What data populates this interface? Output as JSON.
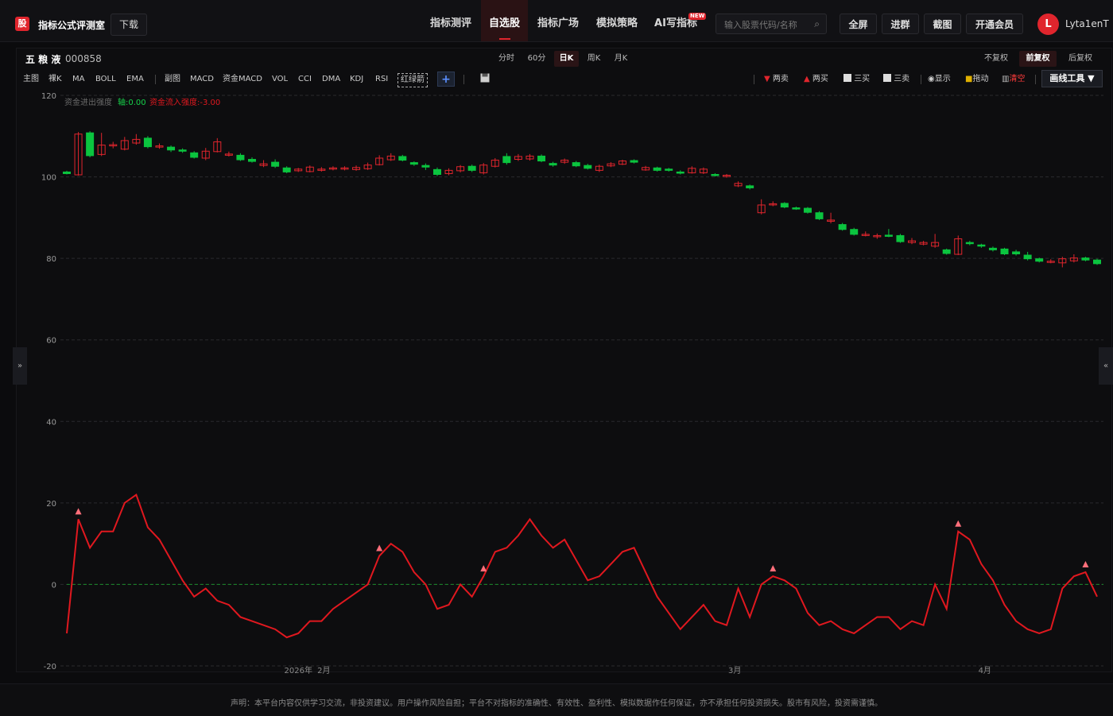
{
  "app": {
    "logo_char": "股",
    "brand": "指标公式评测室",
    "download": "下载"
  },
  "nav": {
    "items": [
      "指标测评",
      "自选股",
      "指标广场",
      "模拟策略",
      "AI写指标"
    ],
    "active": "自选股",
    "new_badge": "NEW"
  },
  "search": {
    "placeholder": "输入股票代码/名称"
  },
  "toolbar": {
    "fullscreen": "全屏",
    "join_group": "进群",
    "screenshot": "截图",
    "membership": "开通会员"
  },
  "user": {
    "avatar_letter": "L",
    "name": "Lyta1enT"
  },
  "stock": {
    "name": "五 粮 液",
    "code": "000858"
  },
  "periods": [
    "分时",
    "60分",
    "日K",
    "周K",
    "月K"
  ],
  "active_period": "日K",
  "adjust": [
    "不复权",
    "前复权",
    "后复权"
  ],
  "active_adjust": "前复权",
  "indicators": [
    "主图",
    "裸K",
    "MA",
    "BOLL",
    "EMA",
    "副图",
    "MACD",
    "资金MACD",
    "VOL",
    "CCI",
    "DMA",
    "KDJ",
    "RSI",
    "红绿箭"
  ],
  "signal_tools": [
    "两卖",
    "两买",
    "三买",
    "三卖",
    "显示",
    "拖动",
    "清空"
  ],
  "draw_tool": "画线工具 ▼",
  "side_arrows": {
    "left": "»",
    "right": "«"
  },
  "colors": {
    "up": "#e0252d",
    "down": "#0bc43f",
    "line": "#e0181f",
    "zero": "#1a8a2a"
  },
  "chart_data": {
    "type": "candlestick+line",
    "y_ticks": [
      "120",
      "100",
      "80",
      "60",
      "40",
      "20",
      "0",
      "-20"
    ],
    "ylim": [
      -20,
      120
    ],
    "x_ticks": [
      "2026年",
      "2月",
      "3月",
      "4月"
    ],
    "legend": {
      "label1": "资金进出强度",
      "label2": "轴:0.00",
      "label3": "资金流入强度:-3.00"
    },
    "candles": [
      {
        "o": 101.2,
        "c": 100.8,
        "h": 101.5,
        "l": 100.6
      },
      {
        "o": 100.5,
        "c": 110.5,
        "h": 111.0,
        "l": 100.3
      },
      {
        "o": 110.8,
        "c": 105.2,
        "h": 111.2,
        "l": 104.8
      },
      {
        "o": 105.5,
        "c": 107.8,
        "h": 110.8,
        "l": 105.1
      },
      {
        "o": 107.6,
        "c": 107.9,
        "h": 108.6,
        "l": 107.0
      },
      {
        "o": 106.8,
        "c": 108.9,
        "h": 109.8,
        "l": 106.5
      },
      {
        "o": 108.3,
        "c": 109.2,
        "h": 110.5,
        "l": 107.9
      },
      {
        "o": 109.5,
        "c": 107.4,
        "h": 110.0,
        "l": 107.0
      },
      {
        "o": 107.3,
        "c": 107.6,
        "h": 108.2,
        "l": 106.9
      },
      {
        "o": 107.3,
        "c": 106.6,
        "h": 107.7,
        "l": 106.1
      },
      {
        "o": 106.6,
        "c": 106.3,
        "h": 107.0,
        "l": 105.9
      },
      {
        "o": 105.9,
        "c": 104.8,
        "h": 106.3,
        "l": 104.5
      },
      {
        "o": 104.6,
        "c": 106.3,
        "h": 107.1,
        "l": 104.1
      },
      {
        "o": 106.2,
        "c": 108.6,
        "h": 109.5,
        "l": 106.0
      },
      {
        "o": 105.4,
        "c": 105.6,
        "h": 106.2,
        "l": 105.0
      },
      {
        "o": 105.3,
        "c": 104.2,
        "h": 105.8,
        "l": 103.9
      },
      {
        "o": 104.3,
        "c": 103.8,
        "h": 104.8,
        "l": 103.5
      },
      {
        "o": 102.8,
        "c": 103.2,
        "h": 104.1,
        "l": 102.4
      },
      {
        "o": 103.6,
        "c": 102.6,
        "h": 104.3,
        "l": 102.2
      },
      {
        "o": 102.2,
        "c": 101.2,
        "h": 102.6,
        "l": 100.9
      },
      {
        "o": 101.5,
        "c": 101.9,
        "h": 102.2,
        "l": 101.2
      },
      {
        "o": 101.3,
        "c": 102.4,
        "h": 102.8,
        "l": 101.1
      },
      {
        "o": 101.6,
        "c": 101.9,
        "h": 102.4,
        "l": 101.3
      },
      {
        "o": 102.0,
        "c": 102.2,
        "h": 102.6,
        "l": 101.6
      },
      {
        "o": 101.9,
        "c": 102.2,
        "h": 102.6,
        "l": 101.6
      },
      {
        "o": 101.8,
        "c": 102.3,
        "h": 102.8,
        "l": 101.5
      },
      {
        "o": 102.0,
        "c": 102.9,
        "h": 103.5,
        "l": 101.7
      },
      {
        "o": 103.0,
        "c": 104.6,
        "h": 105.3,
        "l": 102.8
      },
      {
        "o": 104.2,
        "c": 105.1,
        "h": 105.8,
        "l": 103.9
      },
      {
        "o": 105.0,
        "c": 104.1,
        "h": 105.4,
        "l": 103.8
      },
      {
        "o": 103.5,
        "c": 103.1,
        "h": 103.8,
        "l": 102.7
      },
      {
        "o": 102.8,
        "c": 102.4,
        "h": 103.3,
        "l": 101.7
      },
      {
        "o": 101.8,
        "c": 100.6,
        "h": 102.3,
        "l": 100.2
      },
      {
        "o": 100.8,
        "c": 101.6,
        "h": 102.1,
        "l": 100.4
      },
      {
        "o": 101.5,
        "c": 102.5,
        "h": 102.9,
        "l": 101.1
      },
      {
        "o": 102.6,
        "c": 101.6,
        "h": 103.0,
        "l": 101.2
      },
      {
        "o": 101.0,
        "c": 102.9,
        "h": 103.4,
        "l": 100.6
      },
      {
        "o": 102.6,
        "c": 104.1,
        "h": 104.6,
        "l": 102.3
      },
      {
        "o": 105.0,
        "c": 103.5,
        "h": 105.8,
        "l": 103.0
      },
      {
        "o": 104.3,
        "c": 105.0,
        "h": 105.6,
        "l": 103.9
      },
      {
        "o": 104.4,
        "c": 105.1,
        "h": 105.6,
        "l": 104.0
      },
      {
        "o": 105.1,
        "c": 103.9,
        "h": 105.5,
        "l": 103.6
      },
      {
        "o": 103.3,
        "c": 102.9,
        "h": 103.7,
        "l": 102.5
      },
      {
        "o": 103.6,
        "c": 104.1,
        "h": 104.5,
        "l": 103.2
      },
      {
        "o": 103.5,
        "c": 102.7,
        "h": 103.9,
        "l": 102.4
      },
      {
        "o": 102.8,
        "c": 102.1,
        "h": 103.2,
        "l": 101.8
      },
      {
        "o": 101.6,
        "c": 102.6,
        "h": 103.0,
        "l": 101.2
      },
      {
        "o": 102.7,
        "c": 103.2,
        "h": 103.6,
        "l": 102.4
      },
      {
        "o": 103.1,
        "c": 103.9,
        "h": 104.2,
        "l": 102.9
      },
      {
        "o": 104.0,
        "c": 103.6,
        "h": 104.3,
        "l": 103.3
      },
      {
        "o": 101.7,
        "c": 102.3,
        "h": 102.7,
        "l": 101.5
      },
      {
        "o": 102.2,
        "c": 101.6,
        "h": 102.5,
        "l": 101.3
      },
      {
        "o": 101.9,
        "c": 101.6,
        "h": 102.2,
        "l": 101.3
      },
      {
        "o": 101.2,
        "c": 100.9,
        "h": 101.6,
        "l": 100.6
      },
      {
        "o": 101.0,
        "c": 102.1,
        "h": 102.6,
        "l": 100.8
      },
      {
        "o": 101.0,
        "c": 101.9,
        "h": 102.3,
        "l": 100.7
      },
      {
        "o": 100.6,
        "c": 100.4,
        "h": 100.9,
        "l": 100.1
      },
      {
        "o": 100.1,
        "c": 100.4,
        "h": 100.7,
        "l": 99.8
      },
      {
        "o": 97.8,
        "c": 98.4,
        "h": 98.9,
        "l": 97.5
      },
      {
        "o": 97.8,
        "c": 97.3,
        "h": 98.1,
        "l": 96.9
      },
      {
        "o": 91.2,
        "c": 93.1,
        "h": 94.5,
        "l": 90.8
      },
      {
        "o": 93.2,
        "c": 93.4,
        "h": 94.0,
        "l": 92.8
      },
      {
        "o": 93.5,
        "c": 92.6,
        "h": 93.8,
        "l": 92.3
      },
      {
        "o": 92.4,
        "c": 92.2,
        "h": 92.7,
        "l": 91.9
      },
      {
        "o": 92.3,
        "c": 91.3,
        "h": 92.6,
        "l": 91.0
      },
      {
        "o": 91.2,
        "c": 89.7,
        "h": 91.6,
        "l": 89.4
      },
      {
        "o": 89.2,
        "c": 89.4,
        "h": 91.2,
        "l": 88.6
      },
      {
        "o": 88.3,
        "c": 87.1,
        "h": 88.7,
        "l": 86.8
      },
      {
        "o": 87.1,
        "c": 85.9,
        "h": 87.5,
        "l": 85.6
      },
      {
        "o": 85.7,
        "c": 85.9,
        "h": 86.6,
        "l": 85.4
      },
      {
        "o": 85.4,
        "c": 85.6,
        "h": 86.1,
        "l": 84.8
      },
      {
        "o": 85.7,
        "c": 85.6,
        "h": 87.2,
        "l": 85.2
      },
      {
        "o": 85.6,
        "c": 84.1,
        "h": 86.0,
        "l": 83.8
      },
      {
        "o": 83.9,
        "c": 84.3,
        "h": 85.0,
        "l": 83.5
      },
      {
        "o": 83.5,
        "c": 83.9,
        "h": 84.3,
        "l": 83.2
      },
      {
        "o": 83.0,
        "c": 83.9,
        "h": 86.0,
        "l": 82.6
      },
      {
        "o": 82.1,
        "c": 81.2,
        "h": 82.4,
        "l": 80.9
      },
      {
        "o": 81.0,
        "c": 84.8,
        "h": 85.6,
        "l": 80.8
      },
      {
        "o": 83.9,
        "c": 83.6,
        "h": 84.3,
        "l": 83.2
      },
      {
        "o": 83.3,
        "c": 83.0,
        "h": 83.6,
        "l": 82.6
      },
      {
        "o": 82.5,
        "c": 82.1,
        "h": 82.9,
        "l": 81.7
      },
      {
        "o": 82.3,
        "c": 81.1,
        "h": 82.6,
        "l": 80.8
      },
      {
        "o": 81.6,
        "c": 81.1,
        "h": 82.1,
        "l": 80.7
      },
      {
        "o": 80.8,
        "c": 79.9,
        "h": 81.6,
        "l": 79.5
      },
      {
        "o": 79.9,
        "c": 79.3,
        "h": 80.2,
        "l": 79.0
      },
      {
        "o": 79.1,
        "c": 79.3,
        "h": 79.8,
        "l": 78.8
      },
      {
        "o": 78.9,
        "c": 79.9,
        "h": 80.4,
        "l": 77.8
      },
      {
        "o": 79.4,
        "c": 80.1,
        "h": 81.0,
        "l": 79.0
      },
      {
        "o": 80.1,
        "c": 79.6,
        "h": 80.4,
        "l": 79.3
      },
      {
        "o": 79.6,
        "c": 78.7,
        "h": 79.9,
        "l": 78.4
      }
    ],
    "line": [
      -12.0,
      16.0,
      9.0,
      13.0,
      13.0,
      20.0,
      22.0,
      14.0,
      11.0,
      6.0,
      1.0,
      -3.0,
      -1.0,
      -4.0,
      -5.0,
      -8.0,
      -9.0,
      -10.0,
      -11.0,
      -13.0,
      -12.0,
      -9.0,
      -9.0,
      -6.0,
      -4.0,
      -2.0,
      0.0,
      7.0,
      10.0,
      8.0,
      3.0,
      0.0,
      -6.0,
      -5.0,
      0.0,
      -3.0,
      2.0,
      8.0,
      9.0,
      12.0,
      16.0,
      12.0,
      9.0,
      11.0,
      6.0,
      1.0,
      2.0,
      5.0,
      8.0,
      9.0,
      3.0,
      -3.0,
      -7.0,
      -11.0,
      -8.0,
      -5.0,
      -9.0,
      -10.0,
      -1.0,
      -8.0,
      0.0,
      2.0,
      1.0,
      -1.0,
      -7.0,
      -10.0,
      -9.0,
      -11.0,
      -12.0,
      -10.0,
      -8.0,
      -8.0,
      -11.0,
      -9.0,
      -10.0,
      0.0,
      -6.0,
      13.0,
      11.0,
      5.0,
      1.0,
      -5.0,
      -9.0,
      -11.0,
      -12.0,
      -11.0,
      -1.0,
      2.0,
      3.0,
      -3.0
    ],
    "markers": [
      1,
      27,
      36,
      77,
      61,
      88
    ]
  },
  "disclaimer": "声明：本平台内容仅供学习交流，非投资建议。用户操作风险自担；平台不对指标的准确性、有效性、盈利性、模拟数据作任何保证，亦不承担任何投资损失。股市有风险，投资需谨慎。"
}
